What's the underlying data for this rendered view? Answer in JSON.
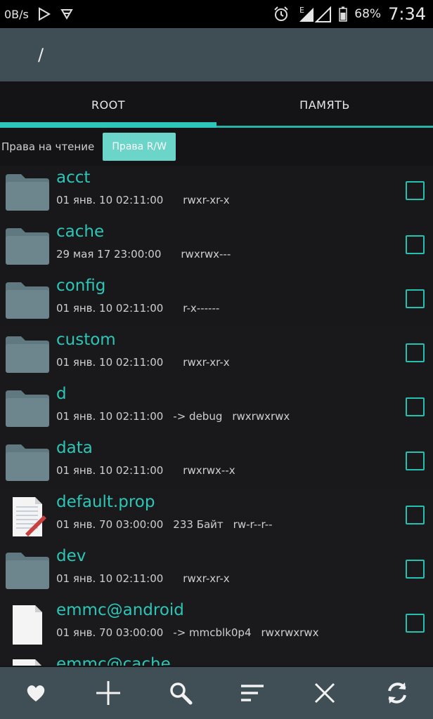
{
  "status_bar": {
    "net_speed": "0B/s",
    "battery": "68%",
    "time": "7:34",
    "network_type": "E",
    "icons": [
      "play-store-icon",
      "cast-icon",
      "alarm-icon",
      "signal-icon",
      "battery-icon"
    ]
  },
  "header": {
    "path": "/"
  },
  "tabs": [
    {
      "label": "ROOT",
      "active": true
    },
    {
      "label": "ПАМЯТЬ",
      "active": false
    }
  ],
  "permissions": {
    "read_label": "Права на чтение",
    "rw_label": "Права R/W"
  },
  "files": [
    {
      "name": "acct",
      "date": "01 янв. 10 02:11:00",
      "link": "",
      "perms": "rwxr-xr-x",
      "type": "folder"
    },
    {
      "name": "cache",
      "date": "29 мая 17 23:00:00",
      "link": "",
      "perms": "rwxrwx---",
      "type": "folder"
    },
    {
      "name": "config",
      "date": "01 янв. 10 02:11:00",
      "link": "",
      "perms": "r-x------",
      "type": "folder"
    },
    {
      "name": "custom",
      "date": "01 янв. 10 02:11:00",
      "link": "",
      "perms": "rwxr-xr-x",
      "type": "folder"
    },
    {
      "name": "d",
      "date": "01 янв. 10 02:11:00",
      "link": "-> debug",
      "perms": "rwxrwxrwx",
      "type": "folder"
    },
    {
      "name": "data",
      "date": "01 янв. 10 02:11:00",
      "link": "",
      "perms": "rwxrwx--x",
      "type": "folder"
    },
    {
      "name": "default.prop",
      "date": "01 янв. 70 03:00:00",
      "link": "233 Байт",
      "perms": "rw-r--r--",
      "type": "text-file"
    },
    {
      "name": "dev",
      "date": "01 янв. 10 02:11:00",
      "link": "",
      "perms": "rwxr-xr-x",
      "type": "folder"
    },
    {
      "name": "emmc@android",
      "date": "01 янв. 70 03:00:00",
      "link": "-> mmcblk0p4",
      "perms": "rwxrwxrwx",
      "type": "file"
    },
    {
      "name": "emmc@cache",
      "date": "",
      "link": "",
      "perms": "",
      "type": "file"
    }
  ],
  "bottom_bar": [
    "favorites-heart-icon",
    "add-plus-icon",
    "search-icon",
    "sort-icon",
    "close-icon",
    "refresh-icon"
  ],
  "colors": {
    "accent": "#2ec6b9",
    "header_bg": "#3e4e54",
    "bottom_bg": "#3f4f55",
    "background": "#141416"
  }
}
